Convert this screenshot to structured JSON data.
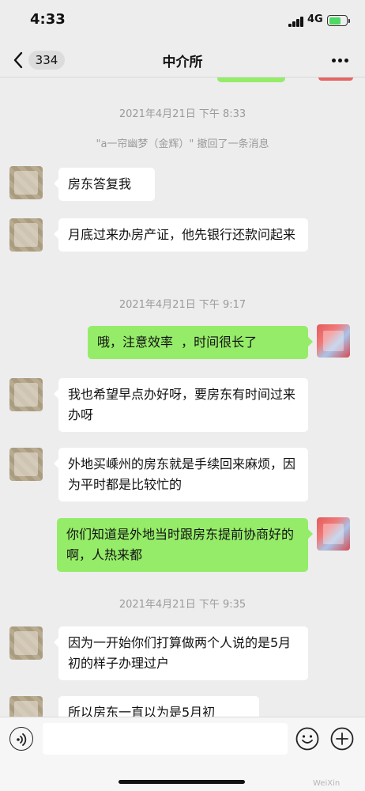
{
  "status_bar": {
    "time": "4:33",
    "network": "4G",
    "battery_level": 0.7
  },
  "header": {
    "back_count": "334",
    "title": "中介所",
    "more_icon": "more-dots-icon"
  },
  "messages": [
    {
      "kind": "timestamp",
      "text": "2021年4月21日 下午 8:33"
    },
    {
      "kind": "recall",
      "text": "\"a一帘幽梦（金辉）\" 撤回了一条消息"
    },
    {
      "kind": "incoming",
      "text": "房东答复我"
    },
    {
      "kind": "incoming",
      "text": "月底过来办房产证，他先银行还款问起来"
    },
    {
      "kind": "timestamp",
      "text": "2021年4月21日 下午 9:17"
    },
    {
      "kind": "outgoing",
      "text": "哦，注意效率  ，时间很长了"
    },
    {
      "kind": "incoming",
      "text": "我也希望早点办好呀，要房东有时间过来办呀"
    },
    {
      "kind": "incoming",
      "text": "外地买嵊州的房东就是手续回来麻烦，因为平时都是比较忙的"
    },
    {
      "kind": "outgoing",
      "text": "你们知道是外地当时跟房东提前协商好的啊，人热来都"
    },
    {
      "kind": "timestamp",
      "text": "2021年4月21日 下午 9:35"
    },
    {
      "kind": "incoming",
      "text": "因为一开始你们打算做两个人说的是5月初的样子办理过户"
    },
    {
      "kind": "incoming",
      "text": "所以房东一直以为是5月初"
    }
  ],
  "input_bar": {
    "value": "",
    "placeholder": "",
    "voice_icon": "voice-icon",
    "emoji_icon": "emoji-icon",
    "plus_icon": "plus-icon",
    "watermark": "WeiXin"
  },
  "colors": {
    "background": "#ededed",
    "outgoing_bubble": "#95ec69",
    "incoming_bubble": "#ffffff",
    "timestamp_text": "#9a9a9a"
  }
}
